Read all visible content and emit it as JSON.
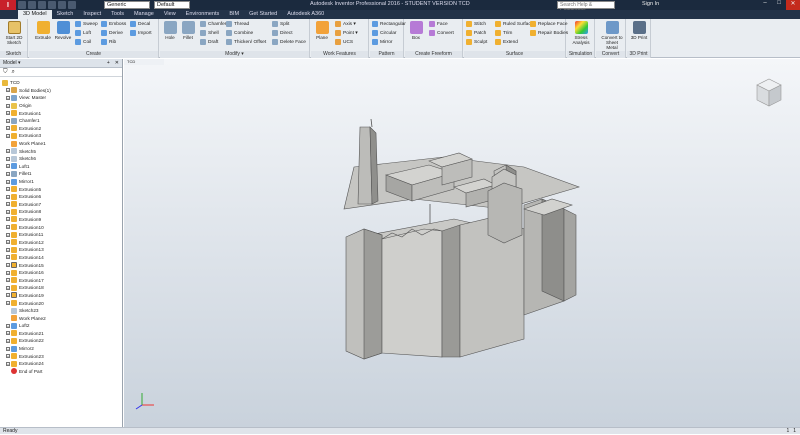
{
  "titlebar": {
    "app_menu": "I",
    "style_select": "Generic",
    "appearance_select": "Default",
    "title": "Autodesk Inventor Professional 2016 - STUDENT VERSION   TCD",
    "search_placeholder": "Search Help & Commands...",
    "signin": "Sign In",
    "min": "–",
    "max": "□",
    "close": "✕"
  },
  "tabs": [
    "3D Model",
    "Sketch",
    "Inspect",
    "Tools",
    "Manage",
    "View",
    "Environments",
    "BIM",
    "Get Started",
    "Autodesk A360"
  ],
  "ribbon": {
    "sketch": {
      "title": "Sketch",
      "start": "Start 2D Sketch"
    },
    "create": {
      "title": "Create",
      "extrude": "Extrude",
      "revolve": "Revolve",
      "sweep": "Sweep",
      "loft": "Loft",
      "coil": "Coil",
      "emboss": "Emboss",
      "derive": "Derive",
      "rib": "Rib",
      "decal": "Decal",
      "import": "Import"
    },
    "modify": {
      "title": "Modify ▾",
      "hole": "Hole",
      "fillet": "Fillet",
      "chamfer": "Chamfer",
      "shell": "Shell",
      "draft": "Draft",
      "thread": "Thread",
      "combine": "Combine",
      "thicken": "Thicken/ Offset",
      "split": "Split",
      "direct": "Direct",
      "delete_face": "Delete Face"
    },
    "work": {
      "title": "Work Features",
      "plane": "Plane",
      "axis": "Axis ▾",
      "point": "Point ▾",
      "ucs": "UCS"
    },
    "pattern": {
      "title": "Pattern",
      "rectangular": "Rectangular",
      "circular": "Circular",
      "mirror": "Mirror"
    },
    "freeform": {
      "title": "Create Freeform",
      "box": "Box",
      "face": "Face",
      "convert": "Convert"
    },
    "surface": {
      "title": "Surface",
      "stitch": "Stitch",
      "patch": "Patch",
      "sculpt": "Sculpt",
      "ruled": "Ruled Surface",
      "trim": "Trim",
      "extend": "Extend",
      "replace": "Replace Face",
      "repair": "Repair Bodies"
    },
    "simulation": {
      "title": "Simulation",
      "stress": "Stress Analysis"
    },
    "convert": {
      "title": "Convert",
      "sheet": "Convert to Sheet Metal"
    },
    "print": {
      "title": "3D Print",
      "label": "3D Print"
    }
  },
  "browser": {
    "title": "Model ▾",
    "add": "+",
    "close": "✕",
    "filter": "⛉",
    "find": "⌕",
    "nodes": [
      "TCD",
      "Solid Bodies(1)",
      "View: Master",
      "Origin",
      "Extrusion1",
      "Chamfer1",
      "Extrusion2",
      "Extrusion3",
      "Work Plane1",
      "Sketch5",
      "Sketch6",
      "Loft1",
      "Fillet1",
      "Mirror1",
      "Extrusion5",
      "Extrusion6",
      "Extrusion7",
      "Extrusion8",
      "Extrusion9",
      "Extrusion10",
      "Extrusion11",
      "Extrusion12",
      "Extrusion13",
      "Extrusion14",
      "Extrusion15",
      "Extrusion16",
      "Extrusion17",
      "Extrusion18",
      "Extrusion19",
      "Extrusion20",
      "Sketch23",
      "Work Plane2",
      "Loft2",
      "Extrusion21",
      "Extrusion22",
      "Mirror2",
      "Extrusion23",
      "Extrusion24",
      "End of Part"
    ]
  },
  "viewport": {
    "tab": "TCD"
  },
  "status": {
    "left": "Ready",
    "count1": "1",
    "count2": "1"
  },
  "colors": {
    "accent": "#1b2a3e",
    "model": "#c9c9c6",
    "shade": "#8e8e8b",
    "dark": "#6f6f6c"
  }
}
